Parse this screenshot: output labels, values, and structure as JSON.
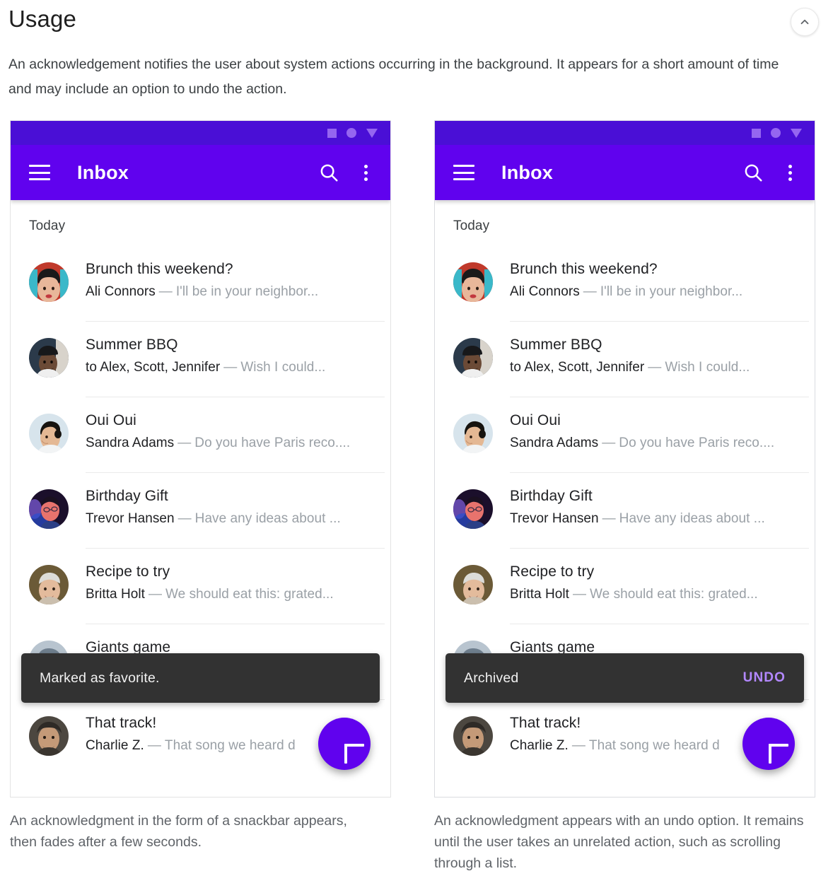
{
  "header": {
    "title": "Usage",
    "collapse_icon": "chevron-up-icon",
    "intro": "An acknowledgement notifies the user about system actions occurring in the background. It appears for a short amount of time and may include an option to undo the action."
  },
  "colors": {
    "appbar_purple": "#6002ee",
    "statusbar_purple": "#4a0fd6",
    "nav_icon_purple": "#9566f0",
    "fab_purple": "#6002ee",
    "snackbar_dark": "#323232",
    "snackbar_action_purple": "#b388ff"
  },
  "statusbar": {
    "icons": [
      "square-icon",
      "circle-icon",
      "triangle-down-icon"
    ]
  },
  "appbar": {
    "menu_icon": "hamburger-menu-icon",
    "title": "Inbox",
    "search_icon": "search-icon",
    "overflow_icon": "more-vertical-icon"
  },
  "list": {
    "section_label": "Today",
    "items": [
      {
        "subject": "Brunch this weekend?",
        "sender": "Ali Connors",
        "dash": "—",
        "preview": "I'll be in your neighbor...",
        "avatar": "avatar-ali-connors"
      },
      {
        "subject": "Summer BBQ",
        "sender": "to Alex, Scott, Jennifer",
        "dash": "—",
        "preview": "Wish I could...",
        "avatar": "avatar-summer-bbq"
      },
      {
        "subject": "Oui Oui",
        "sender": "Sandra Adams",
        "dash": "—",
        "preview": "Do you have Paris reco....",
        "avatar": "avatar-sandra-adams"
      },
      {
        "subject": "Birthday Gift",
        "sender": "Trevor Hansen",
        "dash": "—",
        "preview": "Have any ideas about ...",
        "avatar": "avatar-trevor-hansen"
      },
      {
        "subject": "Recipe to try",
        "sender": "Britta Holt",
        "dash": "—",
        "preview": "We should eat this: grated...",
        "avatar": "avatar-britta-holt"
      },
      {
        "subject": "Giants game",
        "sender": "",
        "dash": "",
        "preview": "",
        "avatar": "avatar-giants-game"
      },
      {
        "subject": "That track!",
        "sender": "Charlie Z.",
        "dash": "—",
        "preview": "That song we heard d",
        "avatar": "avatar-charlie-z"
      }
    ]
  },
  "left_phone": {
    "snackbar": {
      "message": "Marked as favorite.",
      "action": ""
    },
    "fab_icon": "plus-icon",
    "caption": "An acknowledgment in the form of a snackbar appears, then fades after a few seconds."
  },
  "right_phone": {
    "snackbar": {
      "message": "Archived",
      "action": "UNDO"
    },
    "fab_icon": "plus-icon",
    "caption": "An acknowledgment appears with an undo option. It remains until the user takes an unrelated action, such as scrolling through a list."
  }
}
